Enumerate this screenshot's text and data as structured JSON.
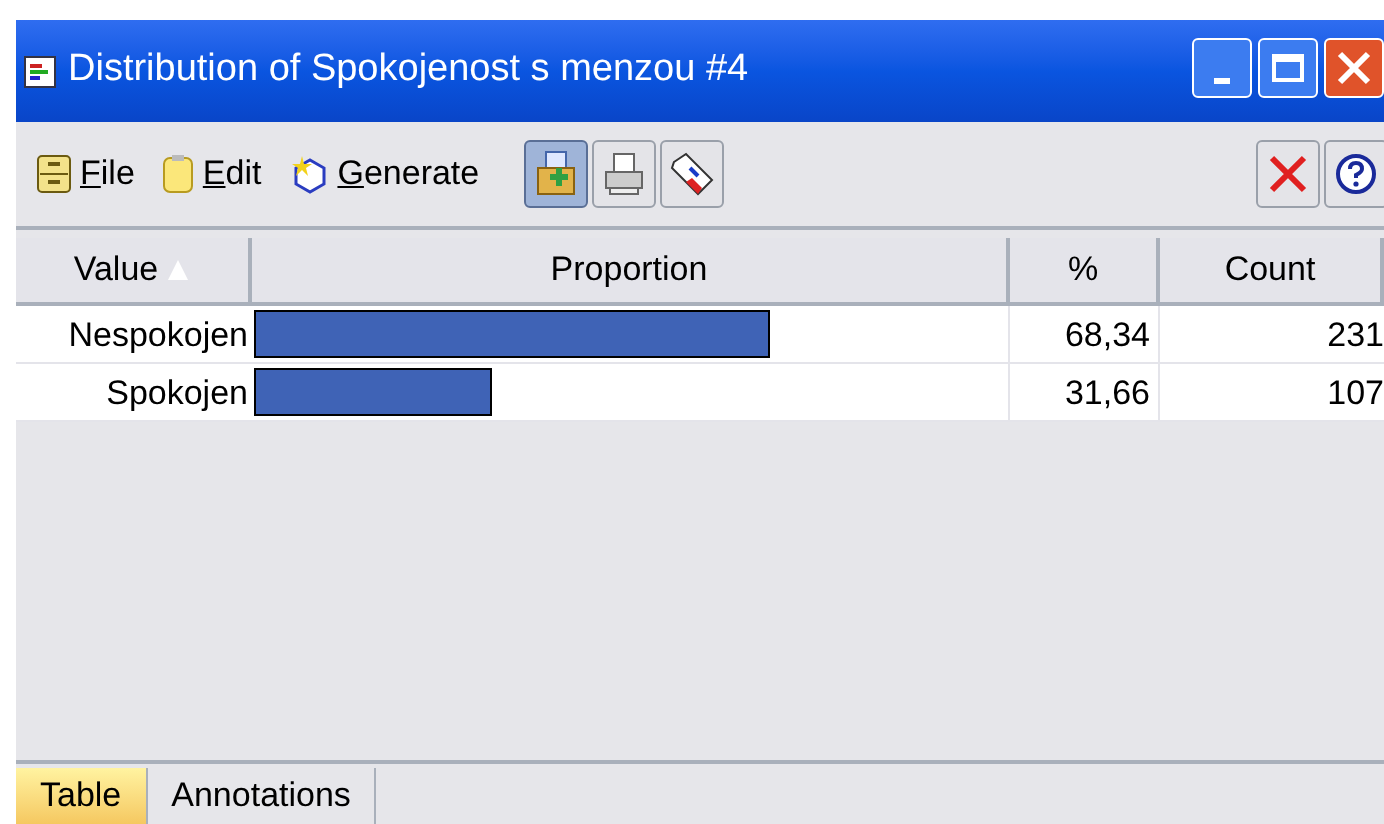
{
  "window": {
    "title": "Distribution of Spokojenost s menzou #4"
  },
  "menu": [
    {
      "label": "File",
      "kind": "file"
    },
    {
      "label": "Edit",
      "kind": "edit"
    },
    {
      "label": "Generate",
      "kind": "generate"
    }
  ],
  "toolbar": [
    {
      "kind": "add",
      "selected": true
    },
    {
      "kind": "print",
      "selected": false
    },
    {
      "kind": "tag",
      "selected": false
    }
  ],
  "table": {
    "columns": [
      "Value",
      "Proportion",
      "%",
      "Count"
    ],
    "rows": [
      {
        "value": "Nespokojen",
        "level": 0.6834,
        "percent": "68,34",
        "count": "231"
      },
      {
        "value": "Spokojen",
        "level": 0.3166,
        "percent": "31,66",
        "count": "107"
      }
    ]
  },
  "tabs": [
    {
      "label": "Table",
      "selected": true
    },
    {
      "label": "Annotations",
      "selected": false
    }
  ]
}
